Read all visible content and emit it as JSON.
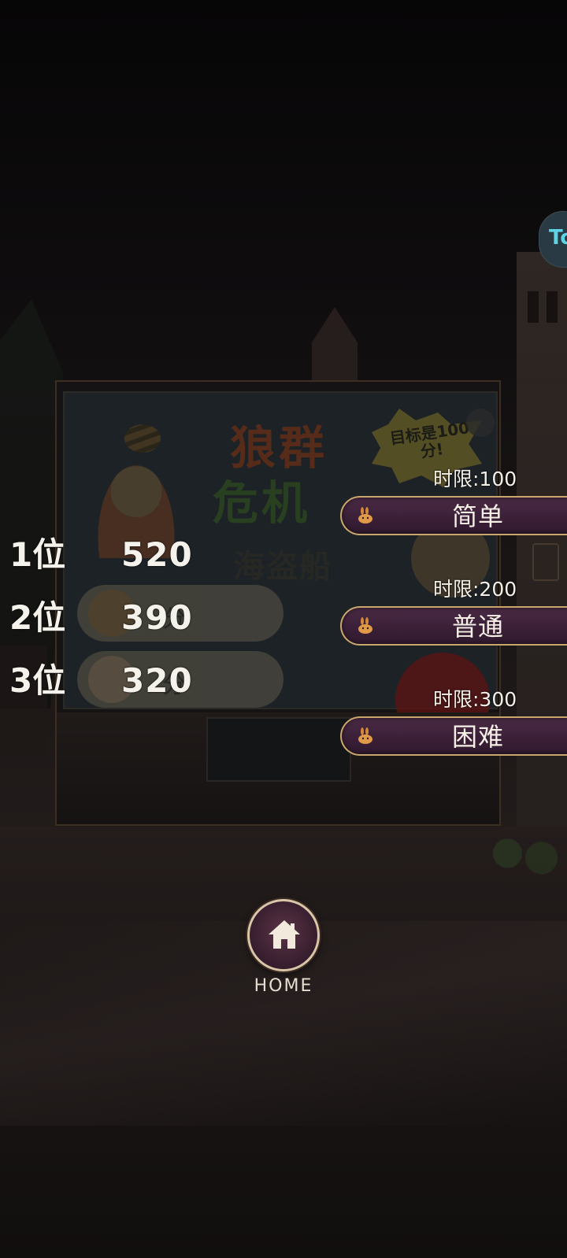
{
  "leaderboard": [
    {
      "rank": "1位",
      "score": "520"
    },
    {
      "rank": "2位",
      "score": "390"
    },
    {
      "rank": "3位",
      "score": "320"
    }
  ],
  "difficulties": [
    {
      "limit": "时限:100",
      "label": "简单"
    },
    {
      "limit": "时限:200",
      "label": "普通"
    },
    {
      "limit": "时限:300",
      "label": "困难"
    }
  ],
  "poster": {
    "title_line1": "狼群",
    "title_line2": "危机",
    "subtitle": "海盗船",
    "burst_text": "目标是100分!",
    "pill_unit": "分"
  },
  "home": {
    "label": "HOME",
    "icon": "house-icon"
  },
  "side_bubble": {
    "text": "To"
  },
  "colors": {
    "button_border": "#c9a66b",
    "button_fill": "#3a1f37",
    "home_ring": "#d9c6a8"
  }
}
